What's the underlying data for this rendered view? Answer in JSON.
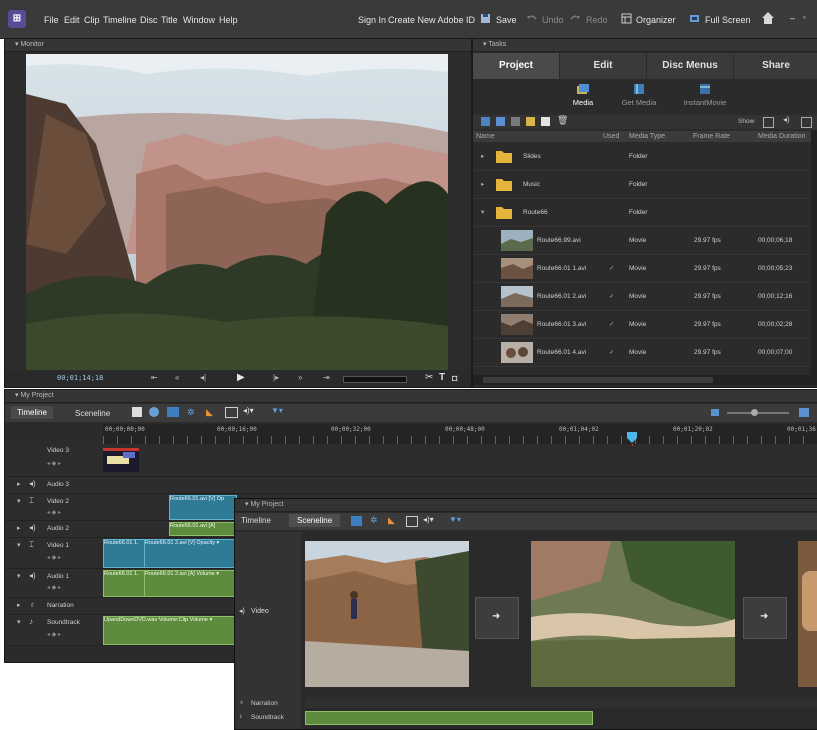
{
  "menubar": {
    "items": [
      "File",
      "Edit",
      "Clip",
      "Timeline",
      "Disc",
      "Title",
      "Window",
      "Help"
    ],
    "sign_in": "Sign In",
    "create_id": "Create New Adobe ID",
    "save": "Save",
    "undo": "Undo",
    "redo": "Redo",
    "organizer": "Organizer",
    "full_screen": "Full Screen"
  },
  "monitor": {
    "title": "Monitor",
    "timecode": "00;01;14;18"
  },
  "tasks": {
    "title": "Tasks",
    "tabs": [
      "Project",
      "Edit",
      "Disc Menus",
      "Share"
    ],
    "subtabs": [
      "Media",
      "Get Media",
      "InstantMovie"
    ],
    "show_label": "Show",
    "columns": [
      "Name",
      "Used",
      "Media Type",
      "Frame Rate",
      "Media Duration"
    ],
    "folders": [
      {
        "name": "Slides",
        "type": "Folder"
      },
      {
        "name": "Music",
        "type": "Folder"
      },
      {
        "name": "Route66",
        "type": "Folder"
      }
    ],
    "files": [
      {
        "name": "Route66.99.avi",
        "used": "",
        "type": "Movie",
        "rate": "29.97 fps",
        "duration": "00;00;06;18"
      },
      {
        "name": "Route66.01 1.avi",
        "used": "✓",
        "type": "Movie",
        "rate": "29.97 fps",
        "duration": "00;00;05;23"
      },
      {
        "name": "Route66.01 2.avi",
        "used": "✓",
        "type": "Movie",
        "rate": "29.97 fps",
        "duration": "00;00;12;16"
      },
      {
        "name": "Route66.01 3.avi",
        "used": "✓",
        "type": "Movie",
        "rate": "29.97 fps",
        "duration": "00;00;02;28"
      },
      {
        "name": "Route66.01 4.avi",
        "used": "✓",
        "type": "Movie",
        "rate": "29.97 fps",
        "duration": "00;00;07;00"
      }
    ]
  },
  "timeline": {
    "title": "My Project",
    "tabs": [
      "Timeline",
      "Sceneline"
    ],
    "ruler": [
      "00;00;00;00",
      "00;00;16;00",
      "00;00;32;00",
      "00;00;48;00",
      "00;01;04;02",
      "00;01;20;02",
      "00;01;36"
    ],
    "tracks": [
      {
        "label": "Video 3"
      },
      {
        "label": "Audio 3"
      },
      {
        "label": "Video 2"
      },
      {
        "label": "Audio 2"
      },
      {
        "label": "Video 1"
      },
      {
        "label": "Audio 1"
      },
      {
        "label": "Narration"
      },
      {
        "label": "Soundtrack"
      }
    ],
    "clips": {
      "v2": "Route66.01.avi [V]  Op",
      "a2": "Route66.01.avi [A]",
      "v1a": "Route66.01 1.",
      "v1b": "Route66.01 2.avi [V]  Opacity ▾",
      "a1a": "Route66.01 1.",
      "a1b": "Route66.01 2.avi [A]  Volume ▾",
      "st": "UpandDownDVD.wav  Volume:Clip Volume ▾"
    }
  },
  "sceneline": {
    "title": "My Project",
    "tabs": [
      "Timeline",
      "Sceneline"
    ],
    "video_label": "Video",
    "narration_label": "Narration",
    "soundtrack_label": "Soundtrack"
  }
}
